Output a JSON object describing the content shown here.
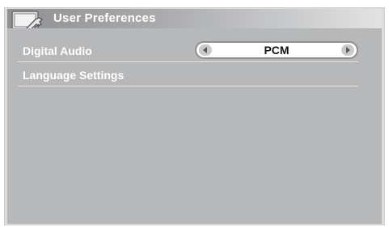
{
  "header": {
    "title": "User Preferences",
    "icon": "tools-icon"
  },
  "settings": [
    {
      "label": "Digital Audio",
      "value": "PCM"
    },
    {
      "label": "Language Settings"
    }
  ],
  "colors": {
    "panel": "#b7b8ba",
    "selector_border": "#8e8f91"
  }
}
